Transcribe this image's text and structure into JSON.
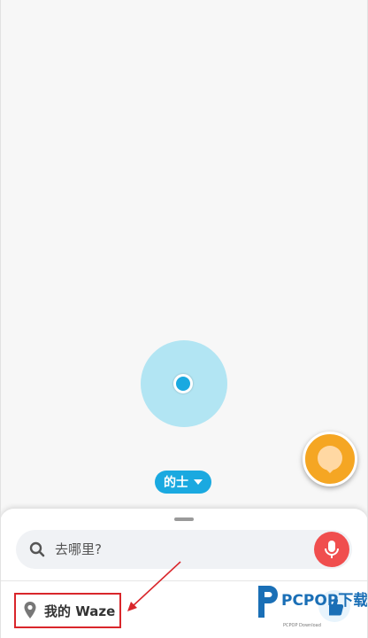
{
  "map": {
    "mode_label": "的士"
  },
  "search": {
    "placeholder": "去哪里?"
  },
  "bottom": {
    "my_waze_label": "我的 Waze"
  },
  "watermark": {
    "brand": "PCPOP下载",
    "sub": "PCPOP Download"
  },
  "colors": {
    "accent_blue": "#1aa9e0",
    "location_ring": "#b2e5f3",
    "mic_red": "#f04e4e",
    "fab_orange": "#f5a623",
    "annotation_red": "#d9262b"
  },
  "icons": [
    "search-icon",
    "microphone-icon",
    "map-pin-icon",
    "chevron-down-icon",
    "waze-smiley-icon",
    "thumbs-up-icon"
  ]
}
